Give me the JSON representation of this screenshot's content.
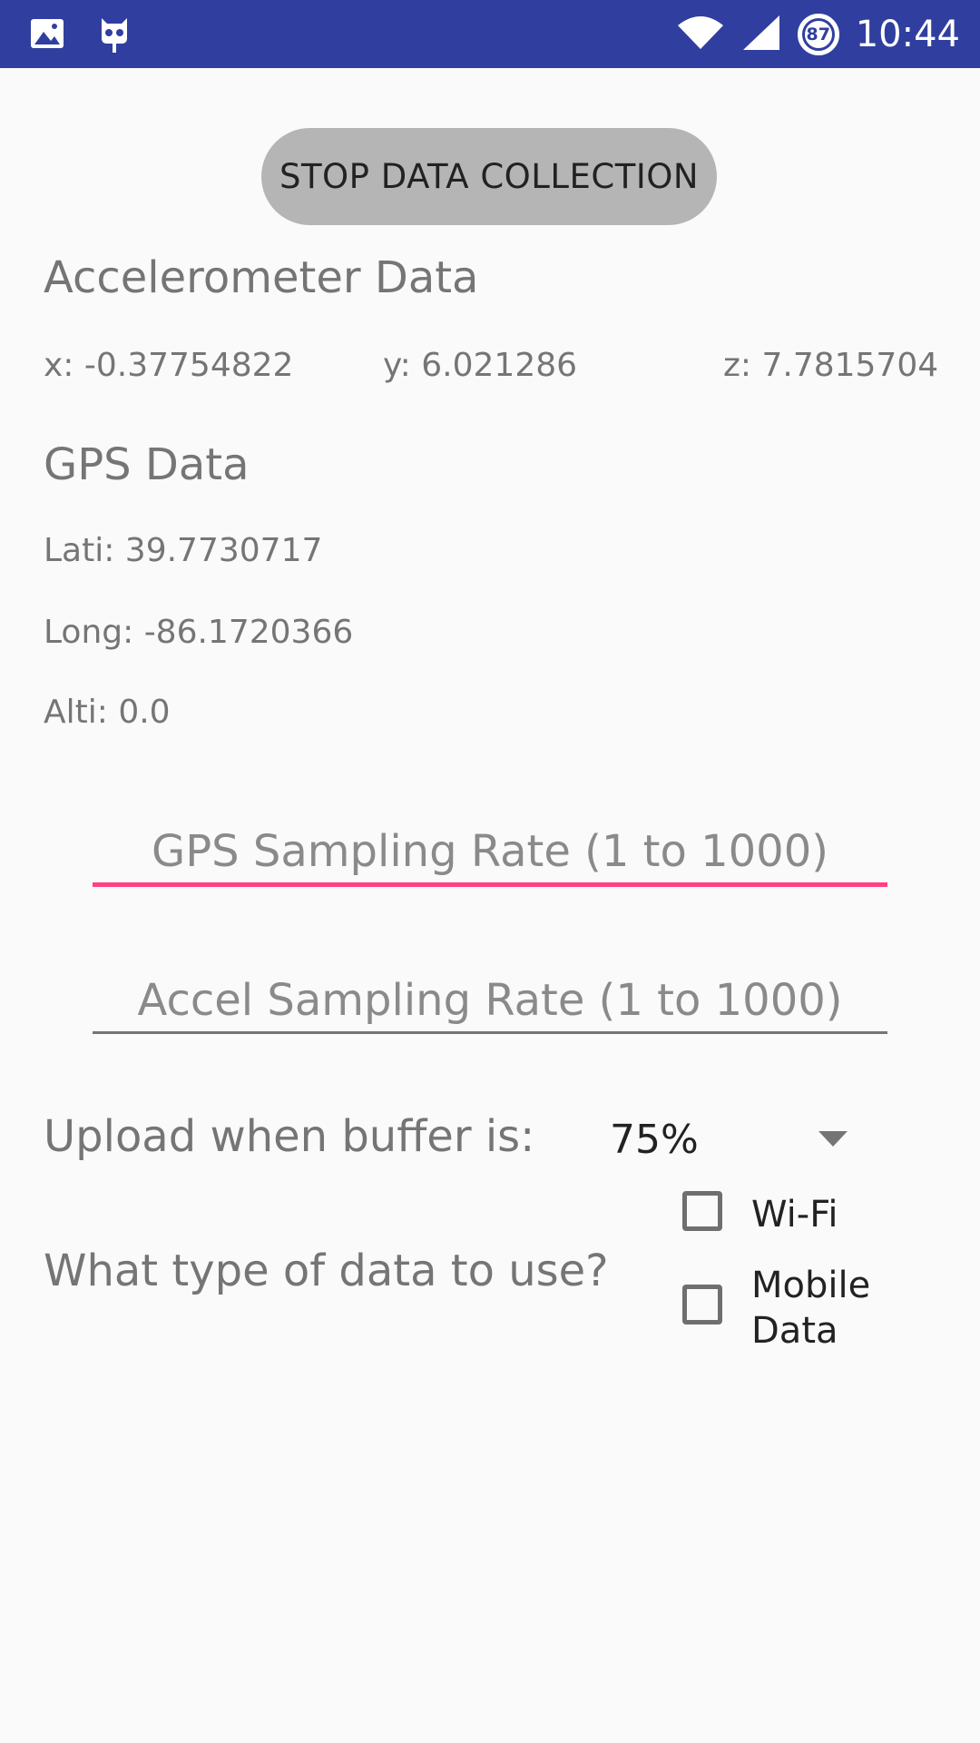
{
  "status_bar": {
    "time": "10:44",
    "battery_level": "87",
    "icons": [
      "image-icon",
      "cyanogen-icon",
      "wifi-icon",
      "signal-icon",
      "battery-icon"
    ],
    "background": "#303f9f"
  },
  "controls": {
    "stop_button_label": "STOP DATA COLLECTION"
  },
  "accelerometer": {
    "title": "Accelerometer Data",
    "x": "x: -0.37754822",
    "y": "y: 6.021286",
    "z": "z: 7.7815704"
  },
  "gps": {
    "title": "GPS Data",
    "lat": "Lati: 39.7730717",
    "long": "Long: -86.1720366",
    "alt": "Alti: 0.0"
  },
  "inputs": {
    "gps_rate_placeholder": "GPS Sampling Rate (1 to 1000)",
    "accel_rate_placeholder": "Accel Sampling Rate (1 to 1000)"
  },
  "upload": {
    "label": "Upload when buffer is:",
    "selected": "75%"
  },
  "data_type": {
    "question": "What type of data to use?",
    "wifi_label": "Wi-Fi",
    "mobile_label_line1": "Mobile",
    "mobile_label_line2": "Data"
  },
  "colors": {
    "accent": "#ff4081",
    "primary_dark": "#303f9f"
  }
}
